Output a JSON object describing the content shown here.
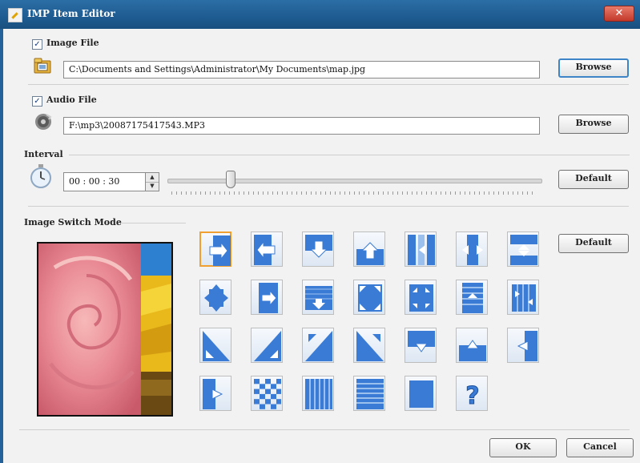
{
  "window": {
    "title": "IMP Item Editor",
    "close_glyph": "✕"
  },
  "image_file": {
    "checkbox_label": "Image File",
    "checked": true,
    "path": "C:\\Documents and Settings\\Administrator\\My Documents\\map.jpg",
    "browse_label": "Browse",
    "icon": "folder-icon"
  },
  "audio_file": {
    "checkbox_label": "Audio File",
    "checked": true,
    "path": "F:\\mp3\\20087175417543.MP3",
    "browse_label": "Browse",
    "icon": "audio-icon"
  },
  "interval": {
    "group_label": "Interval",
    "time_value": "00 : 00 : 30",
    "slider_fraction": 0.16,
    "default_label": "Default",
    "icon": "stopwatch-icon"
  },
  "switch_mode": {
    "group_label": "Image Switch Mode",
    "default_label": "Default",
    "preview_icon": "rose-sunflower-preview",
    "selected_index": 0,
    "modes": [
      "push-right",
      "push-left",
      "push-down",
      "push-up",
      "split-vertical-out",
      "split-vertical-in",
      "split-horizontal-out",
      "expand-center",
      "slide-right",
      "slide-down",
      "expand-corners",
      "shrink-corners",
      "blinds-horizontal",
      "blinds-vertical",
      "diagonal-bottom-left",
      "diagonal-bottom-right",
      "diagonal-top-right",
      "diagonal-top-left",
      "cover-down",
      "cover-up",
      "cover-left",
      "cover-right",
      "checkerboard",
      "bars-vertical",
      "bars-horizontal",
      "fade",
      "random"
    ]
  },
  "footer": {
    "ok_label": "OK",
    "cancel_label": "Cancel"
  },
  "colors": {
    "title_bar": "#1e5b90",
    "tile_blue": "#3a7bd5",
    "selected_tile_border": "#f0a030"
  }
}
